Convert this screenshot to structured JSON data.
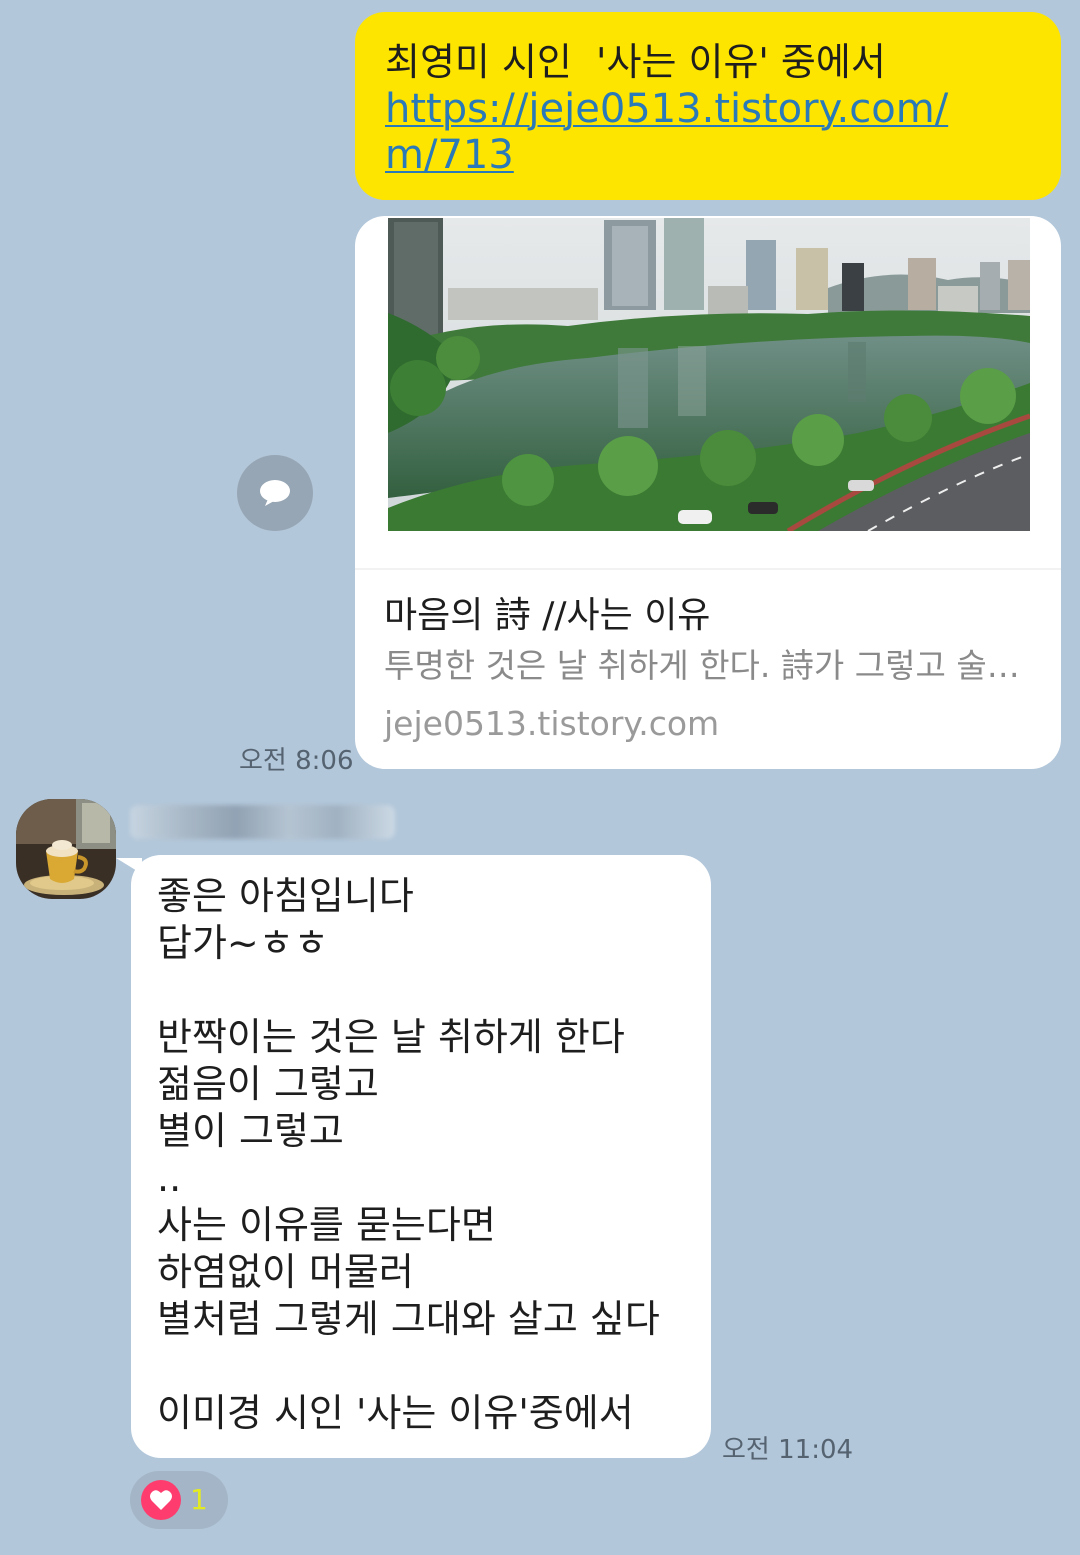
{
  "sent_message": {
    "title": "최영미 시인  '사는 이유' 중에서",
    "link": "https://jeje0513.tistory.com/m/713"
  },
  "link_preview": {
    "title": "마음의 詩 //사는 이유",
    "description": "투명한 것은 날 취하게 한다. 詩가 그렇고 술이 그렇고 아기의 웃음이 그렇고",
    "domain": "jeje0513.tistory.com",
    "image_icon": "city-lake-photo"
  },
  "share_icon": "chat-bubble-icon",
  "sent_time": "오전 8:06",
  "received_message": {
    "lines": [
      "좋은 아침입니다",
      "답가~ㅎㅎ",
      "",
      "반짝이는 것은 날 취하게 한다",
      "젊음이 그렇고",
      "별이 그렇고",
      "..",
      "사는 이유를 묻는다면",
      "하염없이 머물러",
      "별처럼 그렇게 그대와 살고 싶다",
      "",
      "이미경 시인 '사는 이유'중에서"
    ],
    "time": "오전 11:04"
  },
  "reaction": {
    "icon": "heart-icon",
    "count": "1",
    "color": "#ff3c6e"
  },
  "colors": {
    "background": "#b2c7da",
    "sent_bubble": "#fee500",
    "link": "#2a79b8"
  }
}
